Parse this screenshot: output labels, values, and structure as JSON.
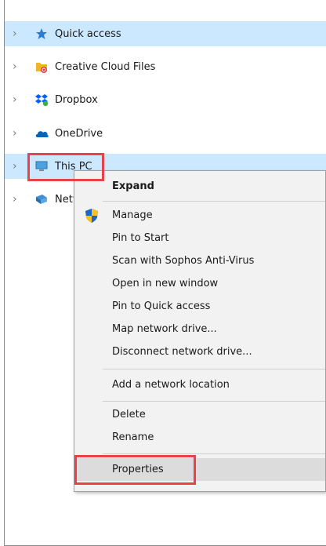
{
  "nav": {
    "items": [
      {
        "label": "Quick access",
        "icon": "star-icon",
        "selected": true
      },
      {
        "label": "Creative Cloud Files",
        "icon": "creative-cloud-folder-icon"
      },
      {
        "label": "Dropbox",
        "icon": "dropbox-icon"
      },
      {
        "label": "OneDrive",
        "icon": "onedrive-cloud-icon"
      },
      {
        "label": "This PC",
        "icon": "computer-icon",
        "selected": true
      },
      {
        "label": "Network",
        "icon": "network-icon"
      }
    ]
  },
  "context_menu": {
    "expand": "Expand",
    "manage": "Manage",
    "pin_to_start": "Pin to Start",
    "scan": "Scan with Sophos Anti-Virus",
    "open_new_window": "Open in new window",
    "pin_quick_access": "Pin to Quick access",
    "map_drive": "Map network drive...",
    "disconnect_drive": "Disconnect network drive...",
    "add_network_location": "Add a network location",
    "delete": "Delete",
    "rename": "Rename",
    "properties": "Properties"
  },
  "colors": {
    "selection": "#cce8ff",
    "highlight_box": "#e8434a",
    "menu_bg": "#f2f2f2"
  }
}
